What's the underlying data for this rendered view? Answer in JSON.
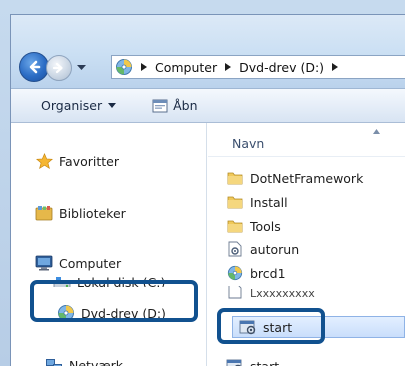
{
  "address": {
    "crumbs": [
      "Computer",
      "Dvd-drev (D:)"
    ]
  },
  "toolbar": {
    "organise_label": "Organiser",
    "open_label": "Åbn"
  },
  "nav": {
    "favorites": "Favoritter",
    "libraries": "Biblioteker",
    "computer": "Computer",
    "local_disk": "Lokal disk (C:)",
    "dvd_drive": "Dvd-drev (D:)",
    "network": "Netværk"
  },
  "files": {
    "column_name": "Navn",
    "items": [
      {
        "name": "DotNetFramework",
        "icon": "folder-icon"
      },
      {
        "name": "Install",
        "icon": "folder-icon"
      },
      {
        "name": "Tools",
        "icon": "folder-icon"
      },
      {
        "name": "autorun",
        "icon": "settings-file-icon"
      },
      {
        "name": "brcd1",
        "icon": "disc-icon"
      },
      {
        "name": "Lxxxxxxxxx",
        "icon": "file-icon"
      },
      {
        "name": "start",
        "icon": "application-icon"
      },
      {
        "name": "start",
        "icon": "application-icon"
      }
    ]
  },
  "colors": {
    "highlight": "#11518f",
    "selection": "#c9defb"
  }
}
